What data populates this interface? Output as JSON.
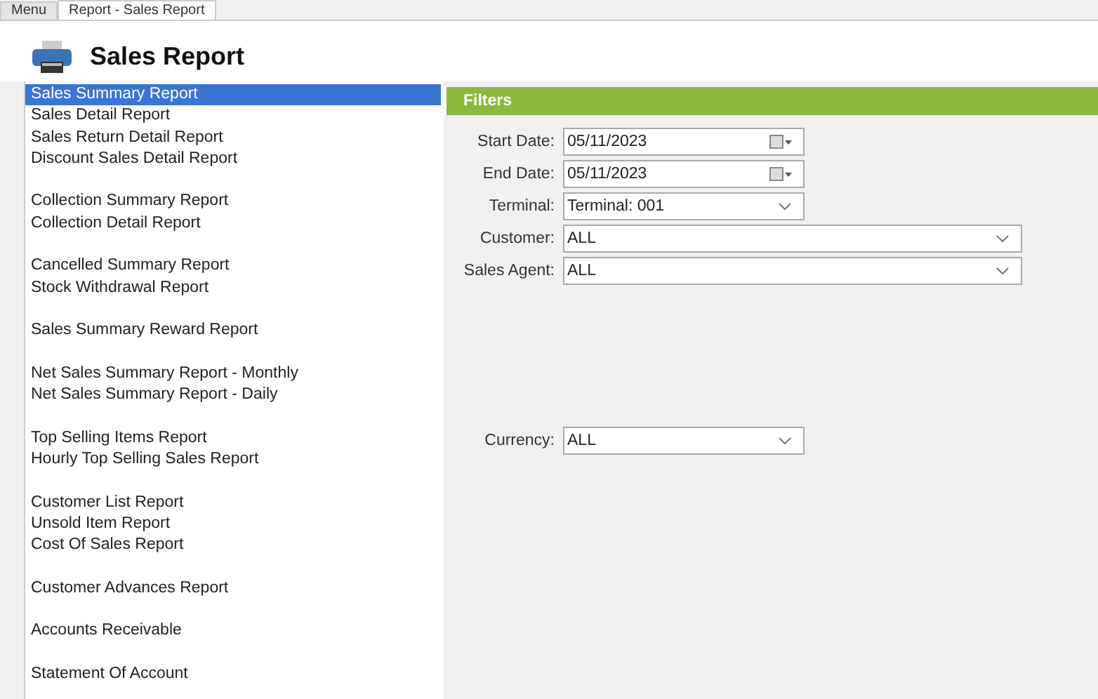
{
  "tabs": [
    {
      "label": "Menu",
      "selected": false
    },
    {
      "label": "Report - Sales Report",
      "selected": true
    }
  ],
  "header": {
    "title": "Sales Report"
  },
  "report_groups": [
    {
      "items": [
        {
          "label": "Sales Summary Report",
          "selected": true
        },
        {
          "label": "Sales Detail Report",
          "selected": false
        },
        {
          "label": "Sales Return Detail Report",
          "selected": false
        },
        {
          "label": "Discount Sales Detail Report",
          "selected": false
        }
      ]
    },
    {
      "items": [
        {
          "label": "Collection Summary Report",
          "selected": false
        },
        {
          "label": "Collection Detail Report",
          "selected": false
        }
      ]
    },
    {
      "items": [
        {
          "label": "Cancelled Summary Report",
          "selected": false
        },
        {
          "label": "Stock Withdrawal Report",
          "selected": false
        }
      ]
    },
    {
      "items": [
        {
          "label": "Sales Summary Reward Report",
          "selected": false
        }
      ]
    },
    {
      "items": [
        {
          "label": "Net Sales Summary Report - Monthly",
          "selected": false
        },
        {
          "label": "Net Sales Summary Report - Daily",
          "selected": false
        }
      ]
    },
    {
      "items": [
        {
          "label": "Top Selling Items Report",
          "selected": false
        },
        {
          "label": "Hourly Top Selling Sales Report",
          "selected": false
        }
      ]
    },
    {
      "items": [
        {
          "label": "Customer List Report",
          "selected": false
        },
        {
          "label": "Unsold Item Report",
          "selected": false
        },
        {
          "label": "Cost Of Sales Report",
          "selected": false
        }
      ]
    },
    {
      "items": [
        {
          "label": "Customer Advances Report",
          "selected": false
        }
      ]
    },
    {
      "items": [
        {
          "label": "Accounts Receivable",
          "selected": false
        }
      ]
    },
    {
      "items": [
        {
          "label": "Statement Of Account",
          "selected": false
        }
      ]
    }
  ],
  "filters": {
    "title": "Filters",
    "fields": [
      {
        "label": "Start Date:",
        "value": "05/11/2023",
        "kind": "date"
      },
      {
        "label": "End Date:",
        "value": "05/11/2023",
        "kind": "date"
      },
      {
        "label": "Terminal:",
        "value": "Terminal: 001",
        "kind": "select"
      },
      {
        "label": "Customer:",
        "value": "ALL",
        "kind": "wide-select"
      },
      {
        "label": "Sales Agent:",
        "value": "ALL",
        "kind": "wide-select"
      }
    ],
    "lower_fields": [
      {
        "label": "Currency:",
        "value": "ALL",
        "kind": "select"
      }
    ]
  }
}
